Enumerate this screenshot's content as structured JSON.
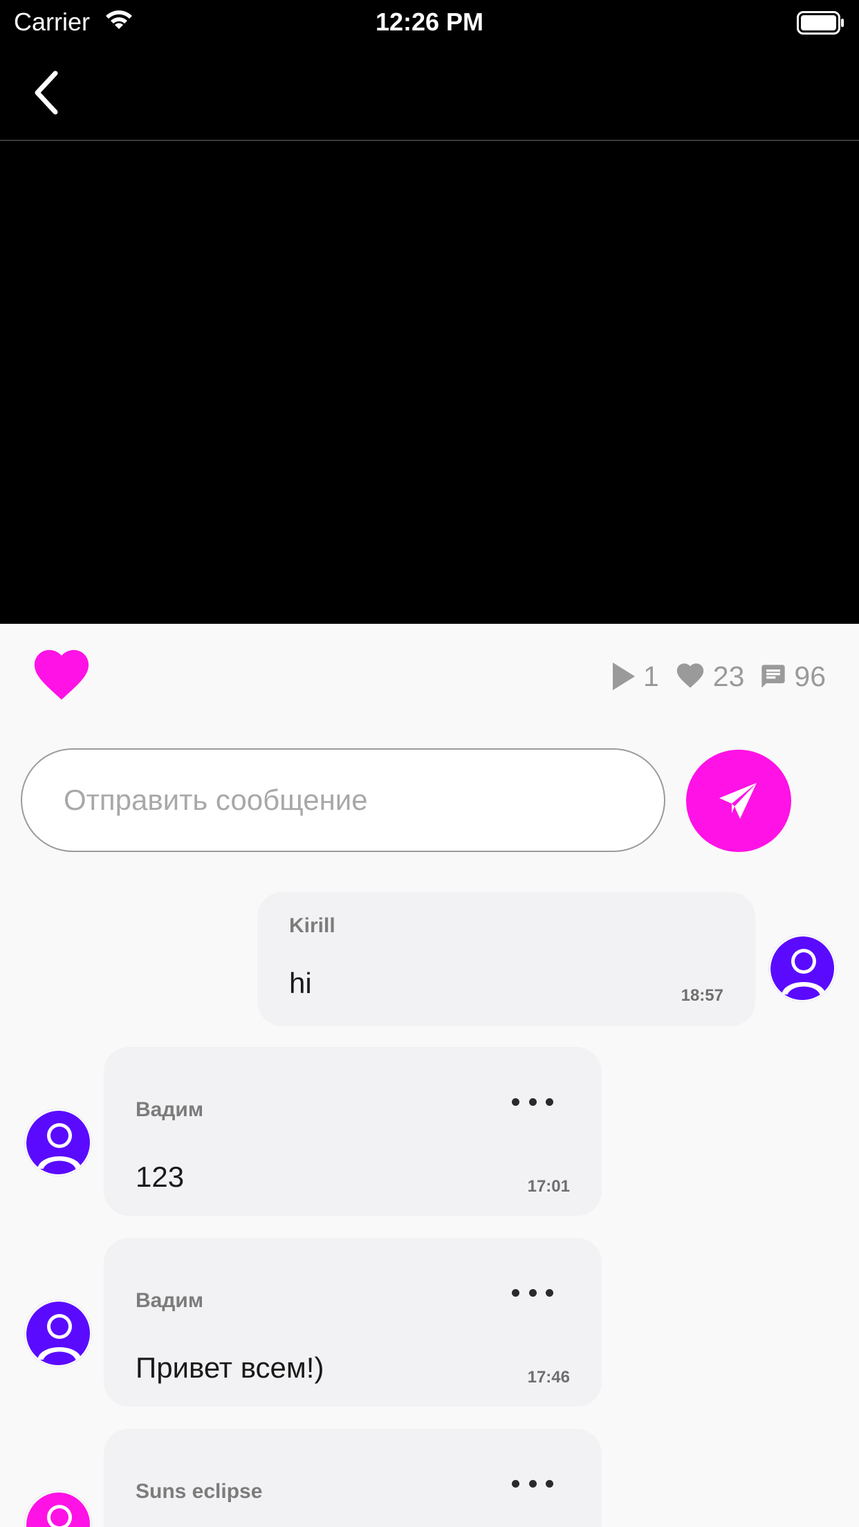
{
  "status_bar": {
    "carrier": "Carrier",
    "time": "12:26 PM"
  },
  "colors": {
    "accent": "#ff12e5",
    "avatar": "#5a0bff",
    "avatar_pink": "#ff12e5"
  },
  "stats": {
    "plays": "1",
    "likes": "23",
    "comments": "96"
  },
  "composer": {
    "placeholder": "Отправить сообщение"
  },
  "messages": [
    {
      "author": "Kirill",
      "text": "hi",
      "time": "18:57",
      "own": true
    },
    {
      "author": "Вадим",
      "text": "123",
      "time": "17:01",
      "own": false
    },
    {
      "author": "Вадим",
      "text": "Привет всем!)",
      "time": "17:46",
      "own": false
    },
    {
      "author": "Suns eclipse",
      "text": "",
      "time": "",
      "own": false
    }
  ],
  "icons": {
    "back": "chevron-left-icon",
    "like": "heart-icon",
    "plays": "play-icon",
    "likes": "heart-icon",
    "comments": "comment-icon",
    "send": "paper-plane-icon",
    "more": "ellipsis-icon",
    "avatar": "user-icon"
  }
}
